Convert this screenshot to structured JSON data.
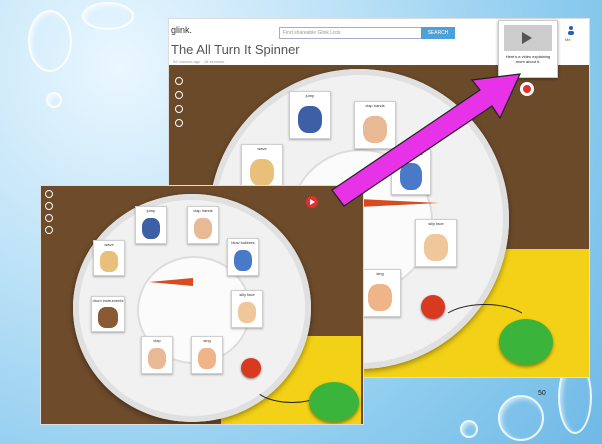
{
  "slide": {
    "page_number": "50"
  },
  "header": {
    "logo": "glink.",
    "search_placeholder": "Find shareable Glink Lists",
    "search_button": "SEARCH",
    "title": "The All Turn It Spinner",
    "meta": "52 minutes ago · 18 seconds",
    "user_label": "Me"
  },
  "popup": {
    "text": "Here's a video explaining more about it."
  },
  "cards": [
    {
      "label": "jump"
    },
    {
      "label": "clap hands"
    },
    {
      "label": "blow bubbles"
    },
    {
      "label": "silly face"
    },
    {
      "label": "sing"
    },
    {
      "label": "wave"
    }
  ],
  "inset_cards": [
    {
      "label": "jump"
    },
    {
      "label": "clap hands"
    },
    {
      "label": "blow bubbles"
    },
    {
      "label": "silly face"
    },
    {
      "label": "sing"
    },
    {
      "label": "clap"
    },
    {
      "label": "drum instruments"
    },
    {
      "label": "wave"
    }
  ],
  "colors": {
    "accent_arrow": "#e832e8",
    "search": "#4ea0d8",
    "play": "#e03030"
  }
}
